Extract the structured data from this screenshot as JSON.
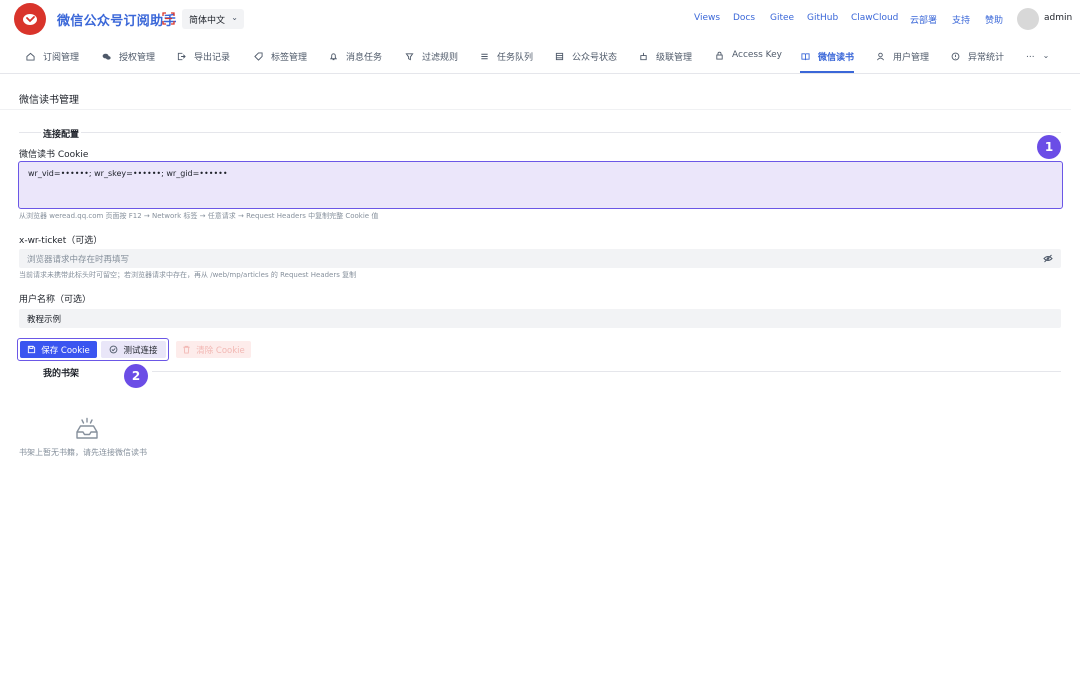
{
  "app": {
    "title": "微信公众号订阅助手",
    "language": "简体中文",
    "brand_color": "#d9342b",
    "accent_color": "#3a67d8"
  },
  "top_links": [
    "Views",
    "Docs",
    "Gitee",
    "GitHub",
    "ClawCloud",
    "云部署",
    "支持",
    "赞助"
  ],
  "user": {
    "name": "admin"
  },
  "nav": {
    "items": [
      {
        "label": "订阅管理",
        "icon": "home-icon"
      },
      {
        "label": "授权管理",
        "icon": "wechat-icon"
      },
      {
        "label": "导出记录",
        "icon": "export-icon"
      },
      {
        "label": "标签管理",
        "icon": "tag-icon"
      },
      {
        "label": "消息任务",
        "icon": "bell-icon"
      },
      {
        "label": "过滤规则",
        "icon": "filter-icon"
      },
      {
        "label": "任务队列",
        "icon": "list-icon"
      },
      {
        "label": "公众号状态",
        "icon": "status-icon"
      },
      {
        "label": "级联管理",
        "icon": "cascade-icon"
      },
      {
        "label": "Access Key",
        "icon": "lock-icon"
      },
      {
        "label": "微信读书",
        "icon": "book-icon"
      },
      {
        "label": "用户管理",
        "icon": "user-icon"
      },
      {
        "label": "异常统计",
        "icon": "alert-icon"
      }
    ],
    "more": "...",
    "active": "微信读书"
  },
  "page": {
    "title": "微信读书管理",
    "connection_section": "连接配置",
    "cookie_label": "微信读书 Cookie",
    "cookie_value": "wr_vid=••••••; wr_skey=••••••; wr_gid=••••••",
    "cookie_help": "从浏览器 weread.qq.com 页面按 F12 → Network 标签 → 任意请求 → Request Headers 中复制完整 Cookie 值",
    "ticket_label": "x-wr-ticket（可选）",
    "ticket_placeholder": "浏览器请求中存在时再填写",
    "ticket_help": "当前请求未携带此标头时可留空；若浏览器请求中存在，再从 /web/mp/articles 的 Request Headers 复制",
    "username_label": "用户名称（可选）",
    "username_value": "教程示例",
    "buttons": {
      "save": "保存 Cookie",
      "test": "测试连接",
      "clear": "清除 Cookie"
    },
    "shelf_section": "我的书架",
    "shelf_empty": "书架上暂无书籍，请先连接微信读书"
  },
  "annotations": {
    "badge_1": "1",
    "badge_2": "2"
  }
}
